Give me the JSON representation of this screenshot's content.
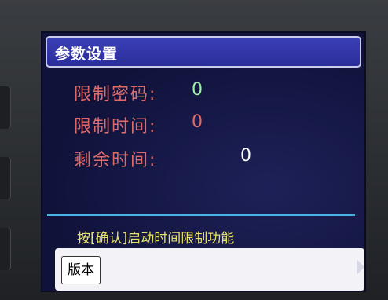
{
  "screen": {
    "title": "参数设置",
    "params": [
      {
        "label": "限制密码:",
        "value": "0",
        "value_color": "#9ff0a8"
      },
      {
        "label": "限制时间:",
        "value": "0",
        "value_color": "#e06a6a"
      },
      {
        "label": "剩余时间:",
        "value": "0",
        "value_color": "#ffffff"
      }
    ],
    "hint": "按[确认]启动时间限制功能",
    "bottom": {
      "version_label": "版本"
    }
  },
  "colors": {
    "screen_bg": "#10123a",
    "title_bar": "#2a2e9a",
    "label_red": "#e06a6a",
    "hint_yellow": "#e7e36a",
    "divider_blue": "#49b3e6"
  }
}
